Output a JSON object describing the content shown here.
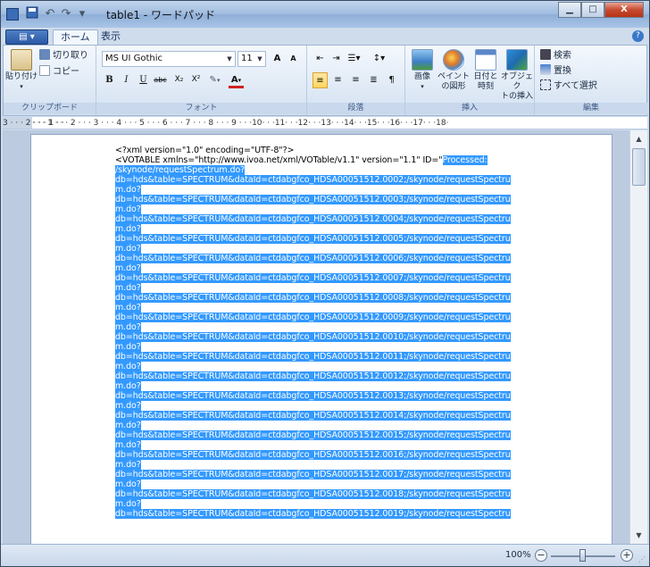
{
  "window": {
    "title": "table1 - ワードパッド",
    "controls": {
      "minimize": "▁",
      "maximize": "□",
      "close": "X"
    }
  },
  "qat": {
    "save_icon": "save-icon",
    "undo_glyph": "↶",
    "redo_glyph": "↷",
    "customize_glyph": "▾"
  },
  "ribbon": {
    "app_menu_glyph": "▤ ▾",
    "tabs": [
      "ホーム",
      "表示"
    ],
    "help_glyph": "?",
    "clipboard": {
      "label": "クリップボード",
      "paste": "貼り付け",
      "cut": "切り取り",
      "copy": "コピー"
    },
    "font": {
      "label": "フォント",
      "font_name": "MS UI Gothic",
      "font_size": "11",
      "grow": "A",
      "shrink": "A",
      "bold": "B",
      "italic": "I",
      "underline": "U",
      "strike": "abc",
      "sub": "X₂",
      "sup": "X²",
      "highlight": "✎",
      "color": "A"
    },
    "paragraph": {
      "label": "段落"
    },
    "insert": {
      "label": "挿入",
      "picture": "画像",
      "paint_line1": "ペイント",
      "paint_line2": "の図形",
      "datetime_line1": "日付と",
      "datetime_line2": "時刻",
      "object_line1": "オブジェク",
      "object_line2": "トの挿入"
    },
    "edit": {
      "label": "編集",
      "find": "検索",
      "replace": "置換",
      "select_all": "すべて選択"
    }
  },
  "ruler": {
    "left_label": "3 · · · 2 · · · 1 · ·",
    "text": "· · · 1 · · · 2 · · · 3 · · · 4 · · · 5 · · · 6 · · · 7 · · · 8 · · · 9 · · ·10· · ·11· · ·12· · ·13· · ·14· · ·15· · ·16· · ·17· · ·18·"
  },
  "document": {
    "line1": "<?xml version=\"1.0\" encoding=\"UTF-8\"?>",
    "line2_plain": "<VOTABLE xmlns=\"http://www.ivoa.net/xml/VOTable/v1.1\" version=\"1.1\" ID=\"",
    "line2_sel": "Processed:",
    "line3_sel": "/skynode/requestSpectrum.do?",
    "entries": [
      {
        "a": "db=hds&table=SPECTRUM&dataId=ctdabgfco_HDSA00051512.0002;/skynode/requestSpectru",
        "b": "m.do?"
      },
      {
        "a": "db=hds&table=SPECTRUM&dataId=ctdabgfco_HDSA00051512.0003;/skynode/requestSpectru",
        "b": "m.do?"
      },
      {
        "a": "db=hds&table=SPECTRUM&dataId=ctdabgfco_HDSA00051512.0004;/skynode/requestSpectru",
        "b": "m.do?"
      },
      {
        "a": "db=hds&table=SPECTRUM&dataId=ctdabgfco_HDSA00051512.0005;/skynode/requestSpectru",
        "b": "m.do?"
      },
      {
        "a": "db=hds&table=SPECTRUM&dataId=ctdabgfco_HDSA00051512.0006;/skynode/requestSpectru",
        "b": "m.do?"
      },
      {
        "a": "db=hds&table=SPECTRUM&dataId=ctdabgfco_HDSA00051512.0007;/skynode/requestSpectru",
        "b": "m.do?"
      },
      {
        "a": "db=hds&table=SPECTRUM&dataId=ctdabgfco_HDSA00051512.0008;/skynode/requestSpectru",
        "b": "m.do?"
      },
      {
        "a": "db=hds&table=SPECTRUM&dataId=ctdabgfco_HDSA00051512.0009;/skynode/requestSpectru",
        "b": "m.do?"
      },
      {
        "a": "db=hds&table=SPECTRUM&dataId=ctdabgfco_HDSA00051512.0010;/skynode/requestSpectru",
        "b": "m.do?"
      },
      {
        "a": "db=hds&table=SPECTRUM&dataId=ctdabgfco_HDSA00051512.0011;/skynode/requestSpectru",
        "b": "m.do?"
      },
      {
        "a": "db=hds&table=SPECTRUM&dataId=ctdabgfco_HDSA00051512.0012;/skynode/requestSpectru",
        "b": "m.do?"
      },
      {
        "a": "db=hds&table=SPECTRUM&dataId=ctdabgfco_HDSA00051512.0013;/skynode/requestSpectru",
        "b": "m.do?"
      },
      {
        "a": "db=hds&table=SPECTRUM&dataId=ctdabgfco_HDSA00051512.0014;/skynode/requestSpectru",
        "b": "m.do?"
      },
      {
        "a": "db=hds&table=SPECTRUM&dataId=ctdabgfco_HDSA00051512.0015;/skynode/requestSpectru",
        "b": "m.do?"
      },
      {
        "a": "db=hds&table=SPECTRUM&dataId=ctdabgfco_HDSA00051512.0016;/skynode/requestSpectru",
        "b": "m.do?"
      },
      {
        "a": "db=hds&table=SPECTRUM&dataId=ctdabgfco_HDSA00051512.0017;/skynode/requestSpectru",
        "b": "m.do?"
      },
      {
        "a": "db=hds&table=SPECTRUM&dataId=ctdabgfco_HDSA00051512.0018;/skynode/requestSpectru",
        "b": "m.do?"
      },
      {
        "a": "db=hds&table=SPECTRUM&dataId=ctdabgfco_HDSA00051512.0019;/skynode/requestSpectru",
        "b": ""
      }
    ]
  },
  "status": {
    "zoom": "100%",
    "zoom_out": "−",
    "zoom_in": "+",
    "zoom_level": 0.5
  },
  "colors": {
    "selection": "#3399ff",
    "ribbon_bg": "#dde8f5"
  }
}
